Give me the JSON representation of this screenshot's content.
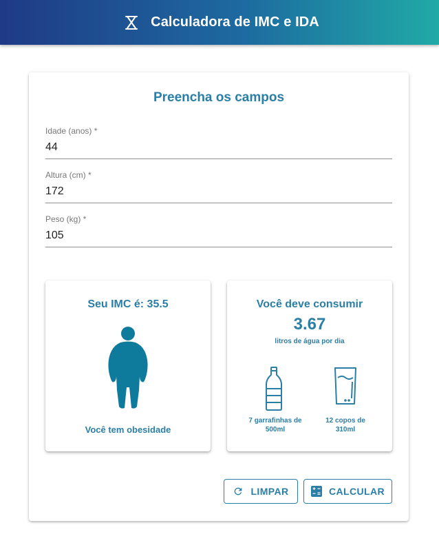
{
  "app_bar": {
    "title": "Calculadora de IMC e IDA",
    "logo_icon": "scale-icon"
  },
  "form": {
    "title": "Preencha os campos",
    "fields": [
      {
        "label": "Idade (anos) *",
        "value": "44"
      },
      {
        "label": "Altura (cm) *",
        "value": "172"
      },
      {
        "label": "Peso (kg) *",
        "value": "105"
      }
    ]
  },
  "imc_card": {
    "title": "Seu IMC é: 35.5",
    "figure_icon": "obese-body-icon",
    "status": "Você tem obesidade"
  },
  "water_card": {
    "title": "Você deve consumir",
    "value": "3.67",
    "unit": "litros de água por dia",
    "bottle_icon": "water-bottle-icon",
    "glass_icon": "water-glass-icon",
    "bottles_line1": "7 garrafinhas de",
    "bottles_line2": "500ml",
    "glasses_line1": "12 copos de",
    "glasses_line2": "310ml"
  },
  "buttons": {
    "clear": {
      "label": "LIMPAR",
      "icon": "refresh-icon"
    },
    "calculate": {
      "label": "CALCULAR",
      "icon": "calculator-icon"
    }
  },
  "colors": {
    "accent": "#2b7ea5",
    "figure": "#0e7a9c",
    "appbar_start": "#1f3a86",
    "appbar_end": "#21aaa6"
  }
}
